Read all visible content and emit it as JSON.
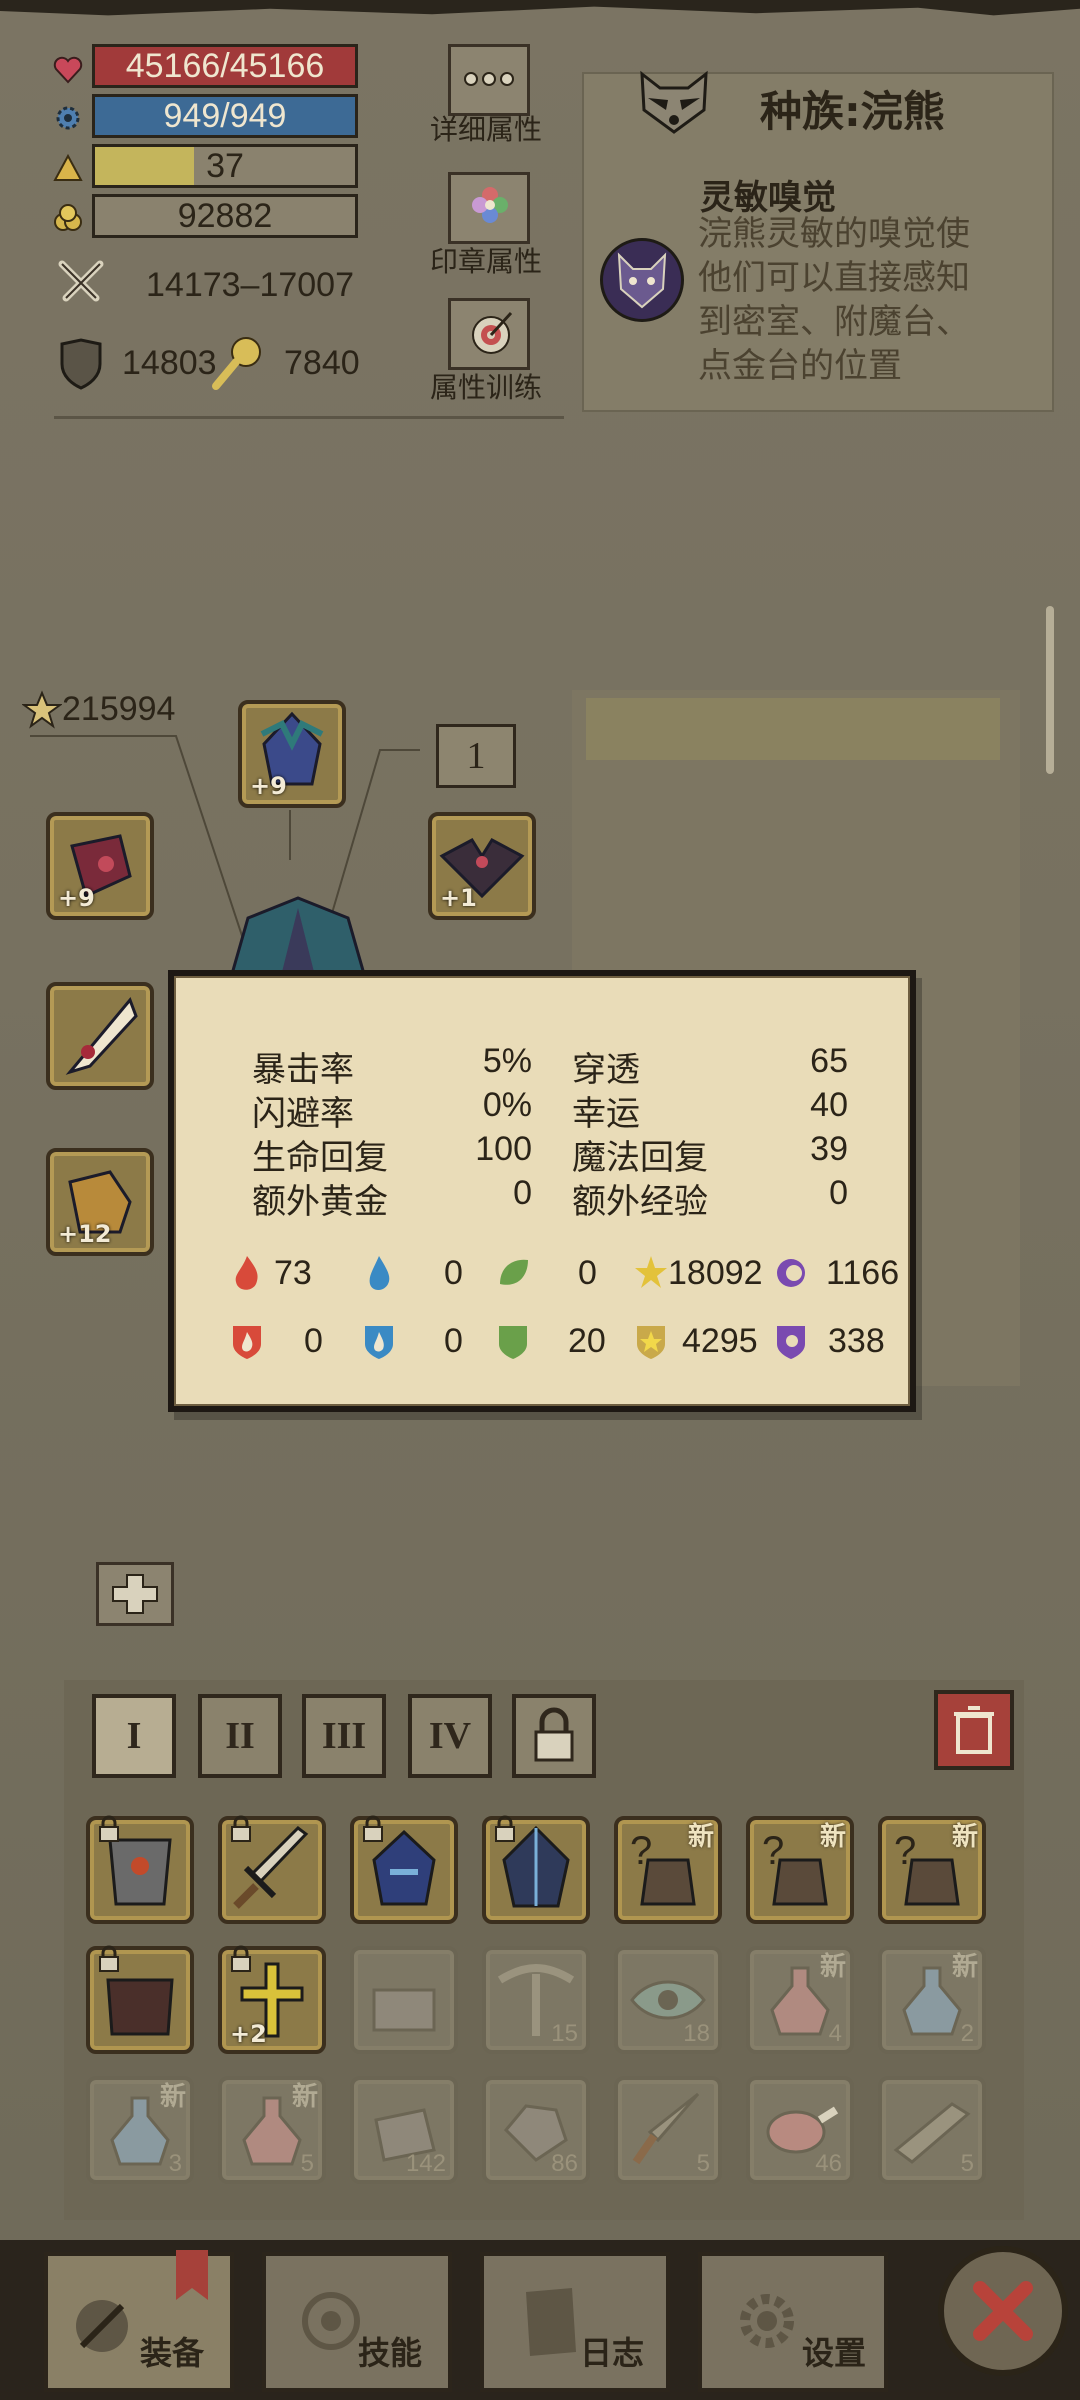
{
  "stats": {
    "hp": "45166/45166",
    "mp": "949/949",
    "level": "37",
    "level_progress": 0.38,
    "gold": "92882",
    "attack": "14173–17007",
    "defense": "14803",
    "luck_value": "7840",
    "star_score": "215994"
  },
  "side_buttons": {
    "detail": "详细属性",
    "seal": "印章属性",
    "training": "属性训练"
  },
  "race": {
    "title": "种族:浣熊",
    "skill_name": "灵敏嗅觉",
    "skill_desc": "浣熊灵敏的嗅觉使他们可以直接感知到密室、附魔台、点金台的位置"
  },
  "equipment": {
    "count_badge": "1",
    "head_plus": "+9",
    "left1_plus": "+9",
    "right1_plus": "+1",
    "left3_plus": "+12"
  },
  "tooltip": {
    "rows": [
      {
        "l1": "暴击率",
        "v1": "5%",
        "l2": "穿透",
        "v2": "65"
      },
      {
        "l1": "闪避率",
        "v1": "0%",
        "l2": "幸运",
        "v2": "40"
      },
      {
        "l1": "生命回复",
        "v1": "100",
        "l2": "魔法回复",
        "v2": "39"
      },
      {
        "l1": "额外黄金",
        "v1": "0",
        "l2": "额外经验",
        "v2": "0"
      }
    ],
    "attack_elems": [
      "73",
      "0",
      "0",
      "18092",
      "1166"
    ],
    "resist_elems": [
      "0",
      "0",
      "20",
      "4295",
      "338"
    ]
  },
  "inventory": {
    "tabs": [
      "I",
      "II",
      "III",
      "IV"
    ],
    "new_label": "新",
    "row1_plus": "+2",
    "counts": {
      "pickaxe": "15",
      "eye": "18",
      "red_potion_a": "4",
      "blue_potion_a": "2",
      "blue_potion_b": "3",
      "red_potion_b": "5",
      "stone": "142",
      "ore": "86",
      "dagger": "5",
      "meat": "46",
      "fish": "5"
    }
  },
  "nav": {
    "equip": "装备",
    "skills": "技能",
    "log": "日志",
    "settings": "设置"
  },
  "colors": {
    "hp": "#a13a3a",
    "mp": "#3d6a95",
    "level": "#c4b55c",
    "parchment": "#e9dcb8"
  }
}
